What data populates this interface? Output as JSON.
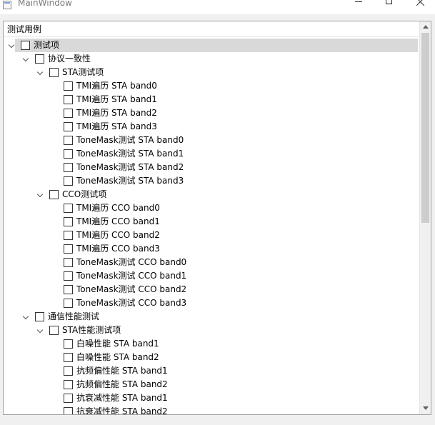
{
  "window": {
    "title": "MainWindow",
    "icons": {
      "app": "app-icon",
      "minimize": "minimize-icon",
      "maximize": "maximize-icon",
      "close": "close-icon"
    }
  },
  "tree": {
    "header": "测试用例",
    "items": [
      {
        "label": "测试项",
        "level": 0,
        "expandable": true,
        "expanded": true,
        "checked": false,
        "selected": true
      },
      {
        "label": "协议一致性",
        "level": 1,
        "expandable": true,
        "expanded": true,
        "checked": false
      },
      {
        "label": "STA测试项",
        "level": 2,
        "expandable": true,
        "expanded": true,
        "checked": false
      },
      {
        "label": "TMI遍历 STA band0",
        "level": 3,
        "expandable": false,
        "checked": false
      },
      {
        "label": "TMI遍历 STA band1",
        "level": 3,
        "expandable": false,
        "checked": false
      },
      {
        "label": "TMI遍历 STA band2",
        "level": 3,
        "expandable": false,
        "checked": false
      },
      {
        "label": "TMI遍历 STA band3",
        "level": 3,
        "expandable": false,
        "checked": false
      },
      {
        "label": "ToneMask测试 STA band0",
        "level": 3,
        "expandable": false,
        "checked": false
      },
      {
        "label": "ToneMask测试 STA band1",
        "level": 3,
        "expandable": false,
        "checked": false
      },
      {
        "label": "ToneMask测试 STA band2",
        "level": 3,
        "expandable": false,
        "checked": false
      },
      {
        "label": "ToneMask测试 STA band3",
        "level": 3,
        "expandable": false,
        "checked": false
      },
      {
        "label": "CCO测试项",
        "level": 2,
        "expandable": true,
        "expanded": true,
        "checked": false
      },
      {
        "label": "TMI遍历 CCO band0",
        "level": 3,
        "expandable": false,
        "checked": false
      },
      {
        "label": "TMI遍历 CCO band1",
        "level": 3,
        "expandable": false,
        "checked": false
      },
      {
        "label": "TMI遍历 CCO band2",
        "level": 3,
        "expandable": false,
        "checked": false
      },
      {
        "label": "TMI遍历 CCO band3",
        "level": 3,
        "expandable": false,
        "checked": false
      },
      {
        "label": "ToneMask测试 CCO band0",
        "level": 3,
        "expandable": false,
        "checked": false
      },
      {
        "label": "ToneMask测试 CCO band1",
        "level": 3,
        "expandable": false,
        "checked": false
      },
      {
        "label": "ToneMask测试 CCO band2",
        "level": 3,
        "expandable": false,
        "checked": false
      },
      {
        "label": "ToneMask测试 CCO band3",
        "level": 3,
        "expandable": false,
        "checked": false
      },
      {
        "label": "通信性能测试",
        "level": 1,
        "expandable": true,
        "expanded": true,
        "checked": false
      },
      {
        "label": "STA性能测试项",
        "level": 2,
        "expandable": true,
        "expanded": true,
        "checked": false
      },
      {
        "label": "白噪性能 STA band1",
        "level": 3,
        "expandable": false,
        "checked": false
      },
      {
        "label": "白噪性能 STA band2",
        "level": 3,
        "expandable": false,
        "checked": false
      },
      {
        "label": "抗频偏性能 STA band1",
        "level": 3,
        "expandable": false,
        "checked": false
      },
      {
        "label": "抗频偏性能 STA band2",
        "level": 3,
        "expandable": false,
        "checked": false
      },
      {
        "label": "抗衰减性能 STA band1",
        "level": 3,
        "expandable": false,
        "checked": false
      },
      {
        "label": "抗衰减性能 STA band2",
        "level": 3,
        "expandable": false,
        "checked": false
      }
    ]
  },
  "scrollbar": {
    "icons": {
      "up": "scroll-up-arrow-icon",
      "down": "scroll-down-arrow-icon"
    },
    "position": 0
  },
  "colors": {
    "selection": "#d9d9d9",
    "frame_border": "#a0a0a0",
    "thumb": "#cdcdcd",
    "title_text": "#7a7a7a"
  }
}
